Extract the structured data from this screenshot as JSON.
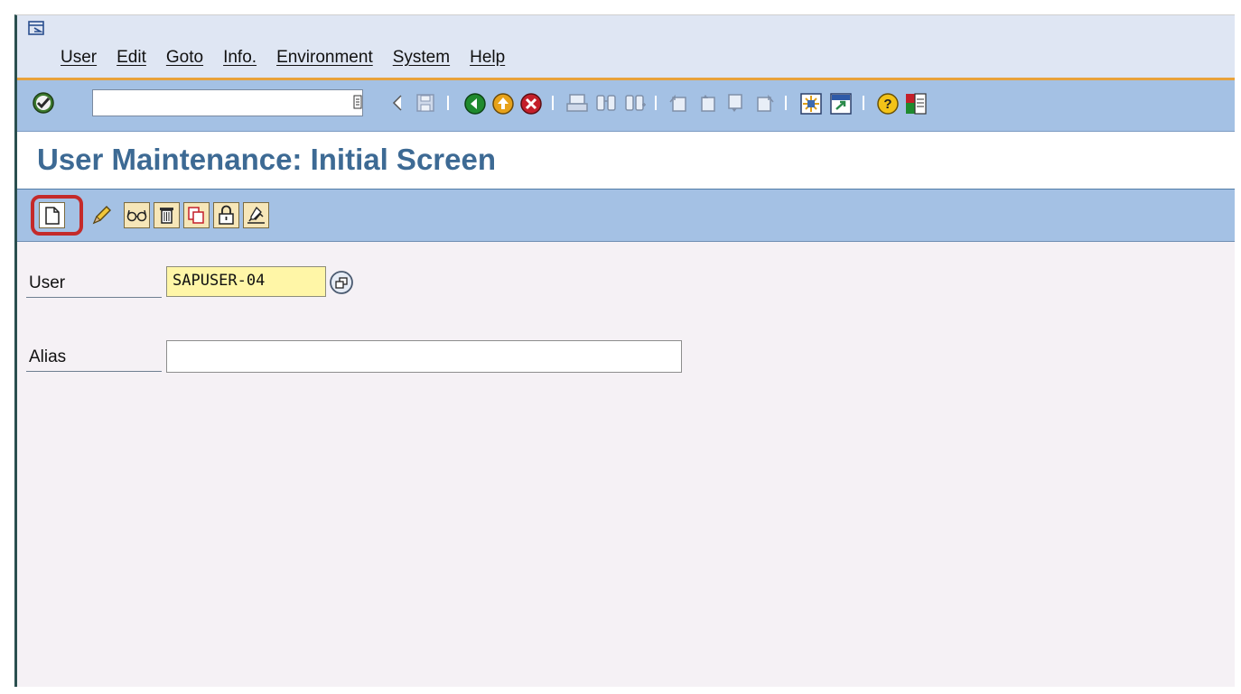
{
  "menu": {
    "items": [
      "User",
      "Edit",
      "Goto",
      "Info.",
      "Environment",
      "System",
      "Help"
    ]
  },
  "system_toolbar": {
    "command_field_value": "",
    "icons": [
      "enter-icon",
      "back-arrow-icon",
      "save-icon",
      "back-icon",
      "exit-icon",
      "cancel-icon",
      "print-icon",
      "find-icon",
      "find-next-icon",
      "first-page-icon",
      "previous-page-icon",
      "next-page-icon",
      "last-page-icon",
      "create-session-icon",
      "shortcut-icon",
      "help-icon",
      "customize-layout-icon"
    ]
  },
  "page": {
    "title": "User Maintenance: Initial Screen"
  },
  "app_toolbar": {
    "buttons": [
      "create-icon",
      "change-icon",
      "display-icon",
      "delete-icon",
      "copy-icon",
      "lock-icon",
      "change-password-icon"
    ]
  },
  "form": {
    "user_label": "User",
    "user_value": "SAPUSER-04",
    "alias_label": "Alias",
    "alias_value": ""
  },
  "colors": {
    "toolbar_bg": "#a4c1e4",
    "title_color": "#3d6a94",
    "highlight": "#c42a2a",
    "required_field": "#fff6a7",
    "menu_underline": "#e8a23a"
  }
}
